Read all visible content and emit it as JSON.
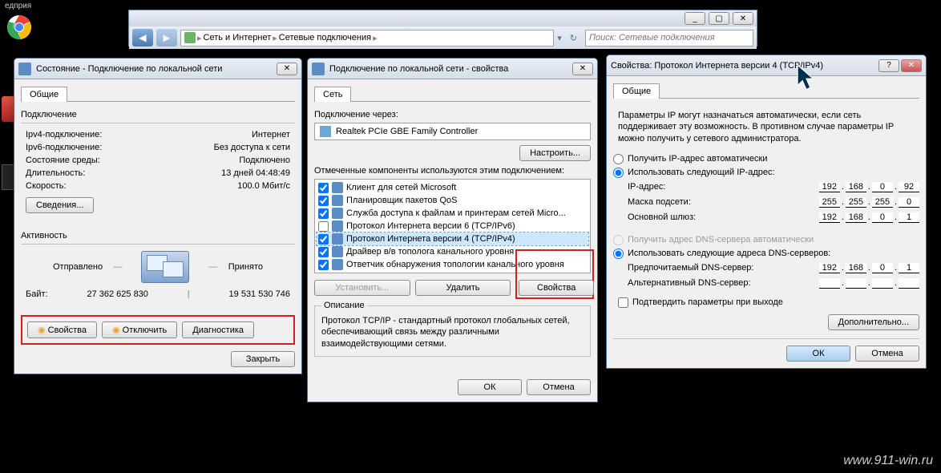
{
  "desktop": {
    "app_label": "едприя"
  },
  "explorer": {
    "crumb1": "Сеть и Интернет",
    "crumb2": "Сетевые подключения",
    "search_placeholder": "Поиск: Сетевые подключения"
  },
  "status_window": {
    "title": "Состояние - Подключение по локальной сети",
    "tab": "Общие",
    "section_conn": "Подключение",
    "rows": [
      {
        "k": "Ipv4-подключение:",
        "v": "Интернет"
      },
      {
        "k": "Ipv6-подключение:",
        "v": "Без доступа к сети"
      },
      {
        "k": "Состояние среды:",
        "v": "Подключено"
      },
      {
        "k": "Длительность:",
        "v": "13 дней 04:48:49"
      },
      {
        "k": "Скорость:",
        "v": "100.0 Мбит/с"
      }
    ],
    "details_btn": "Сведения...",
    "section_act": "Активность",
    "sent_label": "Отправлено",
    "recv_label": "Принято",
    "bytes_label": "Байт:",
    "sent": "27 362 625 830",
    "recv": "19 531 530 746",
    "props_btn": "Свойства",
    "disable_btn": "Отключить",
    "diag_btn": "Диагностика",
    "close_btn": "Закрыть"
  },
  "props_window": {
    "title": "Подключение по локальной сети - свойства",
    "tab": "Сеть",
    "connect_via": "Подключение через:",
    "adapter": "Realtek PCIe GBE Family Controller",
    "configure_btn": "Настроить...",
    "components_label": "Отмеченные компоненты используются этим подключением:",
    "items": [
      {
        "checked": true,
        "label": "Клиент для сетей Microsoft"
      },
      {
        "checked": true,
        "label": "Планировщик пакетов QoS"
      },
      {
        "checked": true,
        "label": "Служба доступа к файлам и принтерам сетей Micro..."
      },
      {
        "checked": false,
        "label": "Протокол Интернета версии 6 (TCP/IPv6)"
      },
      {
        "checked": true,
        "label": "Протокол Интернета версии 4 (TCP/IPv4)",
        "selected": true
      },
      {
        "checked": true,
        "label": "Драйвер в/в тополога канального уровня"
      },
      {
        "checked": true,
        "label": "Ответчик обнаружения топологии канального уровня"
      }
    ],
    "install_btn": "Установить...",
    "remove_btn": "Удалить",
    "item_props_btn": "Свойства",
    "desc_title": "Описание",
    "desc_text": "Протокол TCP/IP - стандартный протокол глобальных сетей, обеспечивающий связь между различными взаимодействующими сетями.",
    "ok": "ОК",
    "cancel": "Отмена"
  },
  "ipv4_window": {
    "title": "Свойства: Протокол Интернета версии 4 (TCP/IPv4)",
    "tab": "Общие",
    "info": "Параметры IP могут назначаться автоматически, если сеть поддерживает эту возможность. В противном случае параметры IP можно получить у сетевого администратора.",
    "auto_ip": "Получить IP-адрес автоматически",
    "use_ip": "Использовать следующий IP-адрес:",
    "ip_label": "IP-адрес:",
    "ip": [
      "192",
      "168",
      "0",
      "92"
    ],
    "mask_label": "Маска подсети:",
    "mask": [
      "255",
      "255",
      "255",
      "0"
    ],
    "gw_label": "Основной шлюз:",
    "gw": [
      "192",
      "168",
      "0",
      "1"
    ],
    "auto_dns": "Получить адрес DNS-сервера автоматически",
    "use_dns": "Использовать следующие адреса DNS-серверов:",
    "dns1_label": "Предпочитаемый DNS-сервер:",
    "dns1": [
      "192",
      "168",
      "0",
      "1"
    ],
    "dns2_label": "Альтернативный DNS-сервер:",
    "dns2": [
      "",
      "",
      "",
      ""
    ],
    "confirm_exit": "Подтвердить параметры при выходе",
    "advanced": "Дополнительно...",
    "ok": "ОК",
    "cancel": "Отмена"
  },
  "watermark": "www.911-win.ru"
}
